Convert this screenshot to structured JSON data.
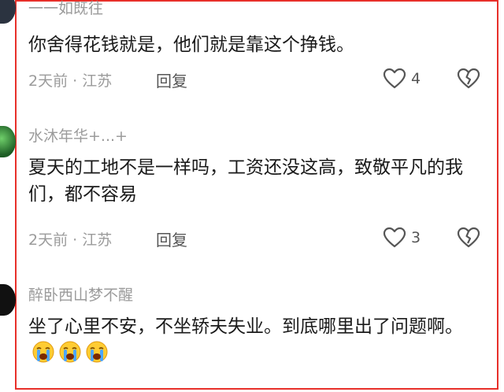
{
  "comments": [
    {
      "username": "一一如既往",
      "text": "你舍得花钱就是，他们就是靠这个挣钱。",
      "meta": "2天前 · 江苏",
      "reply_label": "回复",
      "likes": "4"
    },
    {
      "username": "水沐年华+...+",
      "text": "夏天的工地不是一样吗，工资还没这高，致敬平凡的我们，都不容易",
      "meta": "2天前 · 江苏",
      "reply_label": "回复",
      "likes": "3"
    },
    {
      "username": "醉卧西山梦不醒",
      "text": "坐了心里不安，不坐轿夫失业。到底哪里出了问题啊。",
      "emoji": [
        "loudly-crying-face",
        "loudly-crying-face",
        "loudly-crying-face"
      ]
    }
  ],
  "icons": {
    "like": "heart-outline-icon",
    "dislike": "broken-heart-icon"
  },
  "colors": {
    "highlight_border": "#e8302a",
    "meta_text": "#9b9b9b"
  }
}
